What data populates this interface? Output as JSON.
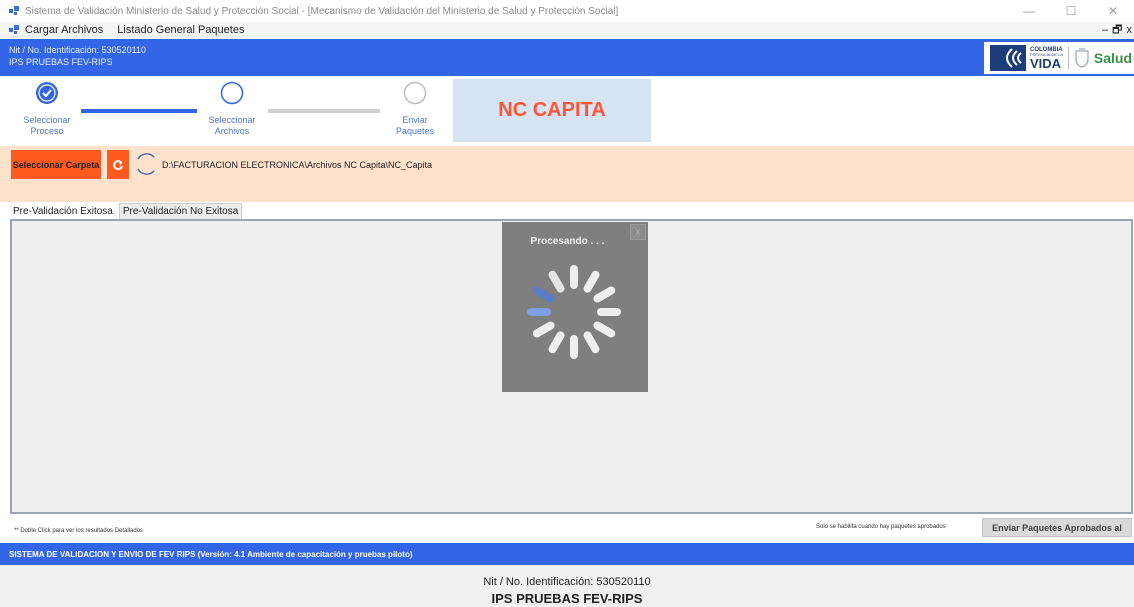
{
  "window": {
    "title": "Sistema de Validación Ministerio de Salud y Protección Social - [Mecanismo de Validación del Ministerio de Salud y Protección Social]",
    "minimize": "—",
    "maximize": "☐",
    "close": "✕"
  },
  "menu": {
    "items": [
      "Cargar Archivos",
      "Listado General Paquetes"
    ],
    "mdi_minimize": "–",
    "mdi_restore": "🗗",
    "mdi_close": "x"
  },
  "header": {
    "nit": "Nit / No. Identificación: 530520110",
    "ips": "IPS PRUEBAS FEV-RIPS",
    "logo": {
      "colombia": "COLOMBIA",
      "potencia": "POTENCIA DE LA",
      "vida": "VIDA",
      "salud": "Salud"
    }
  },
  "steps": [
    {
      "label_line1": "Seleccionar",
      "label_line2": "Proceso",
      "state": "done"
    },
    {
      "label_line1": "Seleccionar",
      "label_line2": "Archivos",
      "state": "current"
    },
    {
      "label_line1": "Enviar",
      "label_line2": "Paquetes",
      "state": "pending"
    }
  ],
  "process_name": "NC CAPITA",
  "folder": {
    "button_label": "Seleccionar Carpeta",
    "refresh_icon": "refresh-icon",
    "path": "D:\\FACTURACION ELECTRONICA\\Archivos NC Capita\\NC_Capita"
  },
  "tabs": [
    "Pre-Validación Exitosa",
    "Pre-Validación No Exitosa"
  ],
  "overlay": {
    "title": "Procesando . . .",
    "close": "X"
  },
  "bottom": {
    "hint": "** Doble Click para ver los resultados Detallados",
    "enable_note": "Solo se habilita cuando hay paquetes aprobados",
    "send_button": "Enviar Paquetes Aprobados al"
  },
  "footer": {
    "system_text": "SISTEMA DE VALIDACION Y ENVIO DE FEV RIPS  (Versión: 4.1 Ambiente de capacitación y pruebas piloto)",
    "nit": "Nit / No. Identificación: 530520110",
    "ips": "IPS PRUEBAS FEV-RIPS"
  },
  "colors": {
    "header_blue": "#3366e6",
    "orange_button": "#ff5a1f",
    "orange_panel": "#ffe2cc",
    "nc_text": "#ff5533"
  }
}
